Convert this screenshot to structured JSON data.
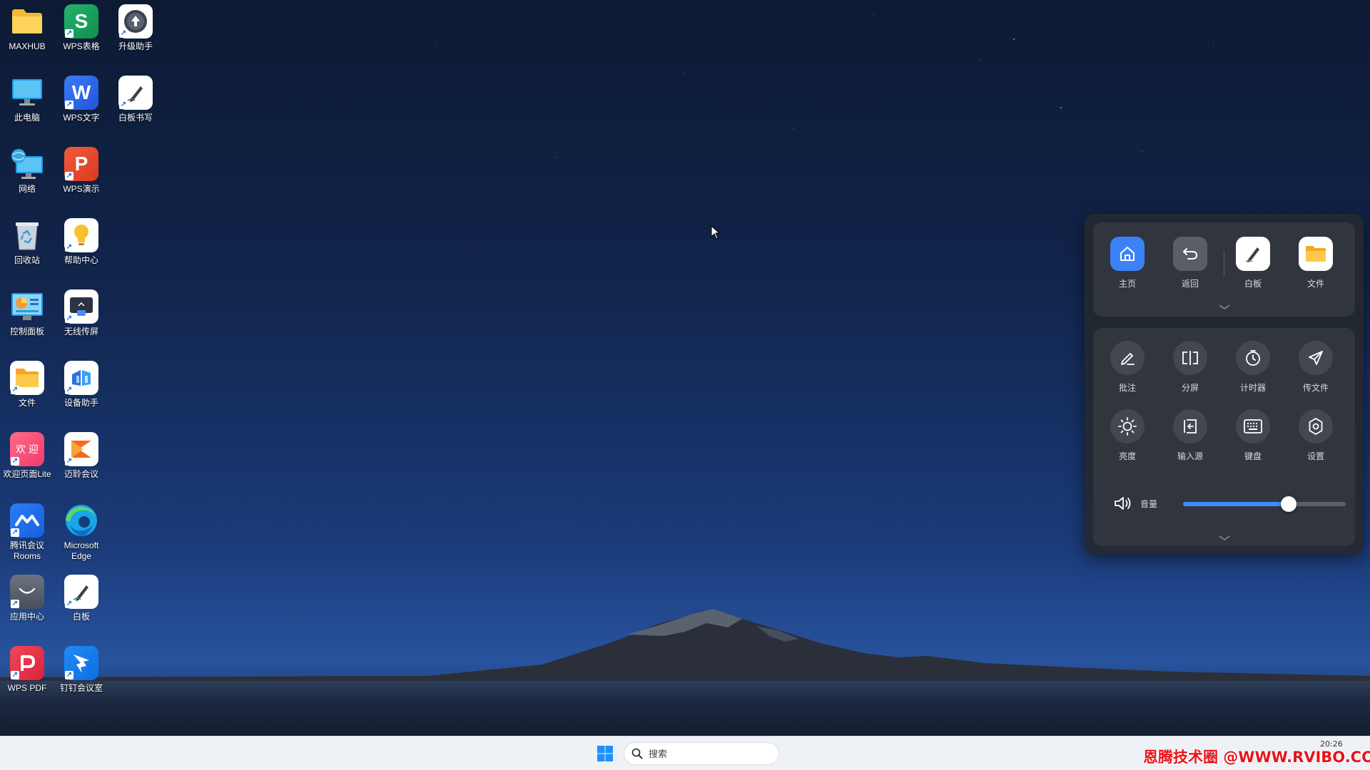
{
  "desktop": {
    "icons": [
      {
        "label": "MAXHUB"
      },
      {
        "label": "此电脑"
      },
      {
        "label": "网络"
      },
      {
        "label": "回收站"
      },
      {
        "label": "控制面板"
      },
      {
        "label": "文件"
      },
      {
        "label": "欢迎页面Lite",
        "tile_text": "欢 迎"
      },
      {
        "label": "腾讯会议Rooms"
      },
      {
        "label": "应用中心"
      },
      {
        "label": "WPS PDF"
      },
      {
        "label": "WPS表格",
        "tile_text": "S"
      },
      {
        "label": "WPS文字",
        "tile_text": "W"
      },
      {
        "label": "WPS演示",
        "tile_text": "P"
      },
      {
        "label": "帮助中心"
      },
      {
        "label": "无线传屏"
      },
      {
        "label": "设备助手"
      },
      {
        "label": "迈聆会议"
      },
      {
        "label": "Microsoft Edge"
      },
      {
        "label": "白板"
      },
      {
        "label": "钉钉会议室"
      },
      {
        "label": "升级助手"
      },
      {
        "label": "白板书写"
      }
    ]
  },
  "panel": {
    "top_buttons": [
      {
        "label": "主页",
        "icon": "home-icon"
      },
      {
        "label": "返回",
        "icon": "back-icon"
      },
      {
        "label": "白板",
        "icon": "whiteboard-icon"
      },
      {
        "label": "文件",
        "icon": "folder-icon"
      }
    ],
    "tools": [
      {
        "label": "批注",
        "icon": "pen-icon"
      },
      {
        "label": "分屏",
        "icon": "split-screen-icon"
      },
      {
        "label": "计时器",
        "icon": "timer-icon"
      },
      {
        "label": "传文件",
        "icon": "send-icon"
      },
      {
        "label": "亮度",
        "icon": "brightness-icon"
      },
      {
        "label": "输入源",
        "icon": "input-source-icon"
      },
      {
        "label": "键盘",
        "icon": "keyboard-icon"
      },
      {
        "label": "设置",
        "icon": "gear-icon"
      }
    ],
    "volume": {
      "label": "音量",
      "level": 0.65
    }
  },
  "taskbar": {
    "search_placeholder": "搜索",
    "clock": "20:26",
    "watermark": "恩腾技术圈 @WWW.RVIBO.COM"
  },
  "colors": {
    "accent": "#3d8bff",
    "home_button": "#3b82f6"
  }
}
